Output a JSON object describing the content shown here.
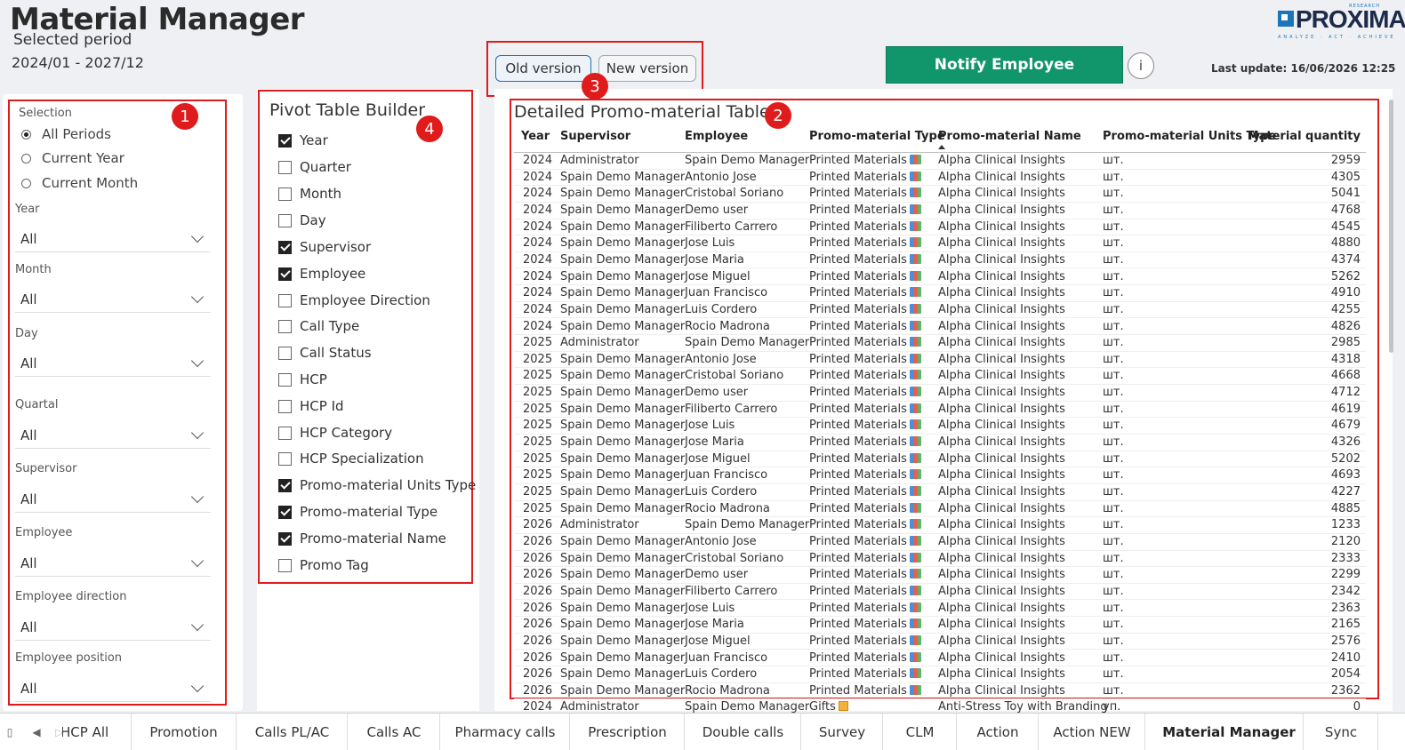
{
  "header": {
    "title": "Material Manager",
    "selected_period_label": "Selected period",
    "period_range": "2024/01 - 2027/12",
    "logo_text": "PROXIMA",
    "logo_research": "RESEARCH",
    "logo_tagline": "ANALYZE · ACT · ACHIEVE",
    "old_version": "Old version",
    "new_version": "New version",
    "notify_label": "Notify Employee",
    "info_label": "i",
    "last_update": "Last update: 16/06/2026 12:25"
  },
  "badges": [
    "1",
    "2",
    "3",
    "4"
  ],
  "filters": {
    "selection_label": "Selection",
    "radios": [
      {
        "label": "All Periods",
        "checked": true
      },
      {
        "label": "Current Year",
        "checked": false
      },
      {
        "label": "Current Month",
        "checked": false
      }
    ],
    "dropdowns": [
      {
        "label": "Year",
        "value": "All"
      },
      {
        "label": "Month",
        "value": "All"
      },
      {
        "label": "Day",
        "value": "All"
      },
      {
        "label": "Quartal",
        "value": "All"
      },
      {
        "label": "Supervisor",
        "value": "All"
      },
      {
        "label": "Employee",
        "value": "All"
      },
      {
        "label": "Employee direction",
        "value": "All"
      },
      {
        "label": "Employee position",
        "value": "All"
      }
    ]
  },
  "pivot": {
    "title": "Pivot Table Builder",
    "items": [
      {
        "label": "Year",
        "checked": true
      },
      {
        "label": "Quarter",
        "checked": false
      },
      {
        "label": "Month",
        "checked": false
      },
      {
        "label": "Day",
        "checked": false
      },
      {
        "label": "Supervisor",
        "checked": true
      },
      {
        "label": "Employee",
        "checked": true
      },
      {
        "label": "Employee Direction",
        "checked": false
      },
      {
        "label": "Call Type",
        "checked": false
      },
      {
        "label": "Call Status",
        "checked": false
      },
      {
        "label": "HCP",
        "checked": false
      },
      {
        "label": "HCP Id",
        "checked": false
      },
      {
        "label": "HCP Category",
        "checked": false
      },
      {
        "label": "HCP Specialization",
        "checked": false
      },
      {
        "label": "Promo-material Units Type",
        "checked": true
      },
      {
        "label": "Promo-material Type",
        "checked": true
      },
      {
        "label": "Promo-material Name",
        "checked": true
      },
      {
        "label": "Promo Tag",
        "checked": false
      }
    ]
  },
  "table": {
    "title": "Detailed Promo-material Table",
    "columns": [
      "Year",
      "Supervisor",
      "Employee",
      "Promo-material Type",
      "Promo-material Name",
      "Promo-material Units Type",
      "Material quantity"
    ],
    "rows": [
      [
        "2024",
        "Administrator",
        "Spain Demo Manager",
        "Printed Materials",
        "Alpha Clinical Insights",
        "шт.",
        "2959"
      ],
      [
        "2024",
        "Spain Demo Manager",
        "Antonio Jose",
        "Printed Materials",
        "Alpha Clinical Insights",
        "шт.",
        "4305"
      ],
      [
        "2024",
        "Spain Demo Manager",
        "Cristobal Soriano",
        "Printed Materials",
        "Alpha Clinical Insights",
        "шт.",
        "5041"
      ],
      [
        "2024",
        "Spain Demo Manager",
        "Demo user",
        "Printed Materials",
        "Alpha Clinical Insights",
        "шт.",
        "4768"
      ],
      [
        "2024",
        "Spain Demo Manager",
        "Filiberto Carrero",
        "Printed Materials",
        "Alpha Clinical Insights",
        "шт.",
        "4545"
      ],
      [
        "2024",
        "Spain Demo Manager",
        "Jose Luis",
        "Printed Materials",
        "Alpha Clinical Insights",
        "шт.",
        "4880"
      ],
      [
        "2024",
        "Spain Demo Manager",
        "Jose Maria",
        "Printed Materials",
        "Alpha Clinical Insights",
        "шт.",
        "4374"
      ],
      [
        "2024",
        "Spain Demo Manager",
        "Jose Miguel",
        "Printed Materials",
        "Alpha Clinical Insights",
        "шт.",
        "5262"
      ],
      [
        "2024",
        "Spain Demo Manager",
        "Juan Francisco",
        "Printed Materials",
        "Alpha Clinical Insights",
        "шт.",
        "4910"
      ],
      [
        "2024",
        "Spain Demo Manager",
        "Luis Cordero",
        "Printed Materials",
        "Alpha Clinical Insights",
        "шт.",
        "4255"
      ],
      [
        "2024",
        "Spain Demo Manager",
        "Rocio Madrona",
        "Printed Materials",
        "Alpha Clinical Insights",
        "шт.",
        "4826"
      ],
      [
        "2025",
        "Administrator",
        "Spain Demo Manager",
        "Printed Materials",
        "Alpha Clinical Insights",
        "шт.",
        "2985"
      ],
      [
        "2025",
        "Spain Demo Manager",
        "Antonio Jose",
        "Printed Materials",
        "Alpha Clinical Insights",
        "шт.",
        "4318"
      ],
      [
        "2025",
        "Spain Demo Manager",
        "Cristobal Soriano",
        "Printed Materials",
        "Alpha Clinical Insights",
        "шт.",
        "4668"
      ],
      [
        "2025",
        "Spain Demo Manager",
        "Demo user",
        "Printed Materials",
        "Alpha Clinical Insights",
        "шт.",
        "4712"
      ],
      [
        "2025",
        "Spain Demo Manager",
        "Filiberto Carrero",
        "Printed Materials",
        "Alpha Clinical Insights",
        "шт.",
        "4619"
      ],
      [
        "2025",
        "Spain Demo Manager",
        "Jose Luis",
        "Printed Materials",
        "Alpha Clinical Insights",
        "шт.",
        "4679"
      ],
      [
        "2025",
        "Spain Demo Manager",
        "Jose Maria",
        "Printed Materials",
        "Alpha Clinical Insights",
        "шт.",
        "4326"
      ],
      [
        "2025",
        "Spain Demo Manager",
        "Jose Miguel",
        "Printed Materials",
        "Alpha Clinical Insights",
        "шт.",
        "5202"
      ],
      [
        "2025",
        "Spain Demo Manager",
        "Juan Francisco",
        "Printed Materials",
        "Alpha Clinical Insights",
        "шт.",
        "4693"
      ],
      [
        "2025",
        "Spain Demo Manager",
        "Luis Cordero",
        "Printed Materials",
        "Alpha Clinical Insights",
        "шт.",
        "4227"
      ],
      [
        "2025",
        "Spain Demo Manager",
        "Rocio Madrona",
        "Printed Materials",
        "Alpha Clinical Insights",
        "шт.",
        "4885"
      ],
      [
        "2026",
        "Administrator",
        "Spain Demo Manager",
        "Printed Materials",
        "Alpha Clinical Insights",
        "шт.",
        "1233"
      ],
      [
        "2026",
        "Spain Demo Manager",
        "Antonio Jose",
        "Printed Materials",
        "Alpha Clinical Insights",
        "шт.",
        "2120"
      ],
      [
        "2026",
        "Spain Demo Manager",
        "Cristobal Soriano",
        "Printed Materials",
        "Alpha Clinical Insights",
        "шт.",
        "2333"
      ],
      [
        "2026",
        "Spain Demo Manager",
        "Demo user",
        "Printed Materials",
        "Alpha Clinical Insights",
        "шт.",
        "2299"
      ],
      [
        "2026",
        "Spain Demo Manager",
        "Filiberto Carrero",
        "Printed Materials",
        "Alpha Clinical Insights",
        "шт.",
        "2342"
      ],
      [
        "2026",
        "Spain Demo Manager",
        "Jose Luis",
        "Printed Materials",
        "Alpha Clinical Insights",
        "шт.",
        "2363"
      ],
      [
        "2026",
        "Spain Demo Manager",
        "Jose Maria",
        "Printed Materials",
        "Alpha Clinical Insights",
        "шт.",
        "2165"
      ],
      [
        "2026",
        "Spain Demo Manager",
        "Jose Miguel",
        "Printed Materials",
        "Alpha Clinical Insights",
        "шт.",
        "2576"
      ],
      [
        "2026",
        "Spain Demo Manager",
        "Juan Francisco",
        "Printed Materials",
        "Alpha Clinical Insights",
        "шт.",
        "2410"
      ],
      [
        "2026",
        "Spain Demo Manager",
        "Luis Cordero",
        "Printed Materials",
        "Alpha Clinical Insights",
        "шт.",
        "2054"
      ],
      [
        "2026",
        "Spain Demo Manager",
        "Rocio Madrona",
        "Printed Materials",
        "Alpha Clinical Insights",
        "шт.",
        "2362"
      ],
      [
        "2024",
        "Administrator",
        "Spain Demo Manager",
        "Gifts",
        "Anti-Stress Toy with Branding",
        "уп.",
        "0"
      ]
    ]
  },
  "tabs": [
    {
      "label": "HCP All",
      "active": false
    },
    {
      "label": "Promotion",
      "active": false
    },
    {
      "label": "Calls PL/AC",
      "active": false
    },
    {
      "label": "Calls AC",
      "active": false
    },
    {
      "label": "Pharmacy calls",
      "active": false
    },
    {
      "label": "Prescription",
      "active": false
    },
    {
      "label": "Double calls",
      "active": false
    },
    {
      "label": "Survey",
      "active": false
    },
    {
      "label": "CLM",
      "active": false
    },
    {
      "label": "Action",
      "active": false
    },
    {
      "label": "Action NEW",
      "active": false
    },
    {
      "label": "Material Manager",
      "active": true
    },
    {
      "label": "Sync",
      "active": false
    }
  ],
  "colors": {
    "accent_red": "#e01b1b",
    "notify_green": "#11956b",
    "brand_blue": "#1b75bb"
  }
}
